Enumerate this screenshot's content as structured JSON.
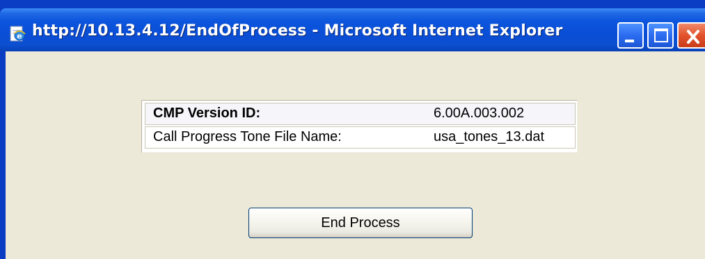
{
  "window": {
    "title": "http://10.13.4.12/EndOfProcess - Microsoft Internet Explorer",
    "icon": "ie-page-icon",
    "controls": [
      "minimize",
      "maximize",
      "close"
    ]
  },
  "info_table": {
    "rows": [
      {
        "label": "CMP Version ID:",
        "value": "6.00A.003.002"
      },
      {
        "label": "Call Progress Tone File Name:",
        "value": "usa_tones_13.dat"
      }
    ]
  },
  "actions": {
    "end_process_label": "End Process"
  },
  "colors": {
    "titlebar": "#0a4ed6",
    "client_background": "#ece9d8",
    "close_button": "#e3522b"
  }
}
